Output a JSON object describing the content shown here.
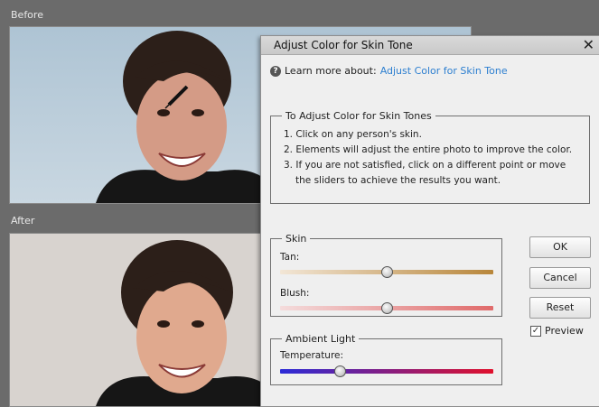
{
  "panes": {
    "before_label": "Before",
    "after_label": "After"
  },
  "dialog": {
    "title": "Adjust Color for Skin Tone",
    "close_glyph": "✕",
    "learn_more_prefix": "Learn more about:",
    "learn_more_link": "Adjust Color for Skin Tone",
    "instructions": {
      "legend": "To Adjust Color for Skin Tones",
      "steps": [
        "1. Click on any person's skin.",
        "2. Elements will adjust the entire photo to improve the color.",
        "3. If you are not satisfied, click on a different point or move the sliders to achieve the results you want."
      ]
    },
    "skin": {
      "legend": "Skin",
      "tan_label": "Tan:",
      "tan_value": 0.5,
      "blush_label": "Blush:",
      "blush_value": 0.5
    },
    "ambient": {
      "legend": "Ambient Light",
      "temperature_label": "Temperature:",
      "temperature_value": 0.28
    },
    "buttons": {
      "ok": "OK",
      "cancel": "Cancel",
      "reset": "Reset"
    },
    "preview": {
      "label": "Preview",
      "checked": true
    }
  },
  "colors": {
    "link": "#2d7fd0",
    "tan_gradient": [
      "#f2e6d6",
      "#b8863a"
    ],
    "blush_gradient": [
      "#f4dcdc",
      "#e06a6a"
    ],
    "temperature_gradient": [
      "#2b2bd8",
      "#e0102c"
    ]
  }
}
